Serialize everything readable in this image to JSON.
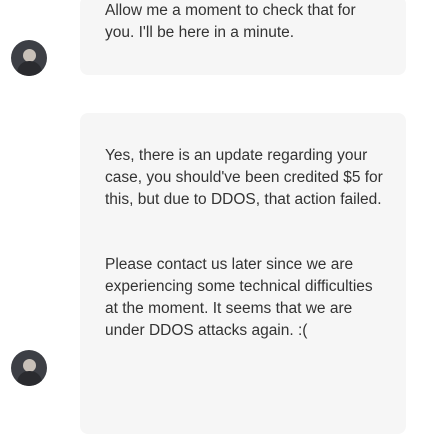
{
  "messages": [
    {
      "sender": "agent",
      "paragraphs": [
        "Allow me a moment to check that for you. I'll be here in a minute."
      ]
    },
    {
      "sender": "agent",
      "paragraphs": [
        "Yes, there is an update regarding your case, you should've been credited $5 for this, but due to DDOS, that action failed.",
        "Please contact us later since we are experiencing some technical difficulties at the moment. It seems that we are under DDOS attacks again. :("
      ]
    }
  ],
  "colors": {
    "bubble_bg": "#f6f6f6",
    "text": "#333333",
    "avatar_bg": "#3d3f45"
  }
}
